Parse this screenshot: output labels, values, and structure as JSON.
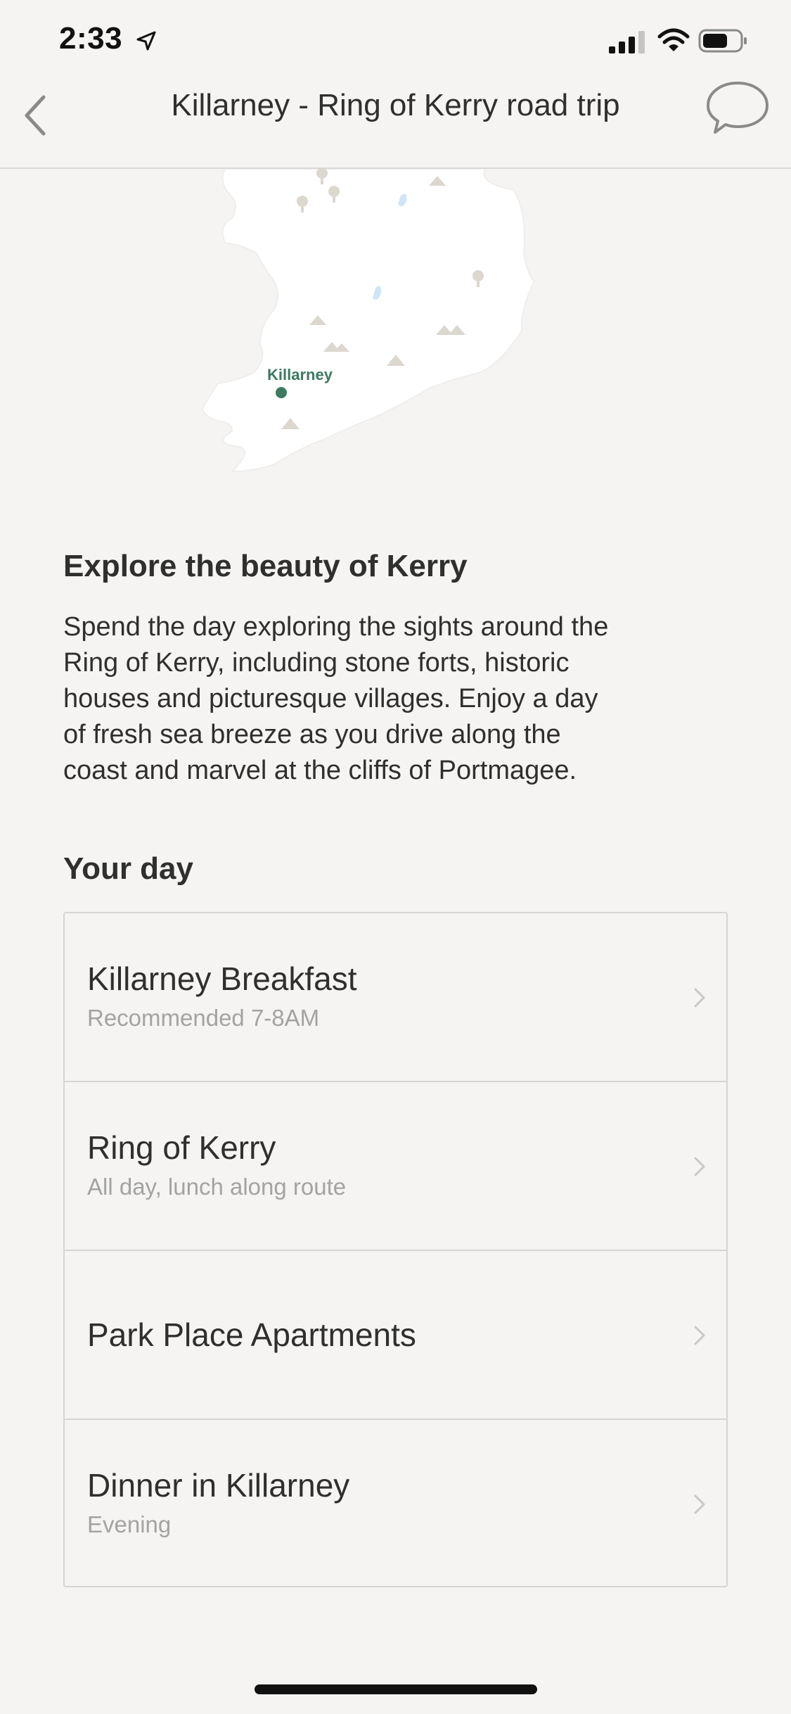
{
  "status_bar": {
    "time": "2:33",
    "icons": [
      "location-arrow-icon",
      "cellular-signal-icon",
      "wifi-icon",
      "battery-icon"
    ]
  },
  "nav": {
    "title": "Killarney - Ring of Kerry road trip",
    "back_icon": "chevron-left-icon",
    "chat_icon": "speech-bubble-icon"
  },
  "map": {
    "pin_label": "Killarney",
    "accent_color": "#3d7a61"
  },
  "intro": {
    "heading": "Explore the beauty of Kerry",
    "lines": [
      "Spend the day exploring the sights around the",
      "Ring of Kerry, including stone forts, historic",
      "houses and picturesque villages. Enjoy a day",
      "of fresh sea breeze as you drive along the",
      "coast and marvel at the cliffs of Portmagee."
    ]
  },
  "your_day": {
    "heading": "Your day",
    "items": [
      {
        "title": "Killarney Breakfast",
        "subtitle": "Recommended 7-8AM"
      },
      {
        "title": "Ring of Kerry",
        "subtitle": "All day, lunch along route"
      },
      {
        "title": "Park Place Apartments"
      },
      {
        "title": "Dinner in Killarney",
        "subtitle": "Evening"
      }
    ]
  }
}
